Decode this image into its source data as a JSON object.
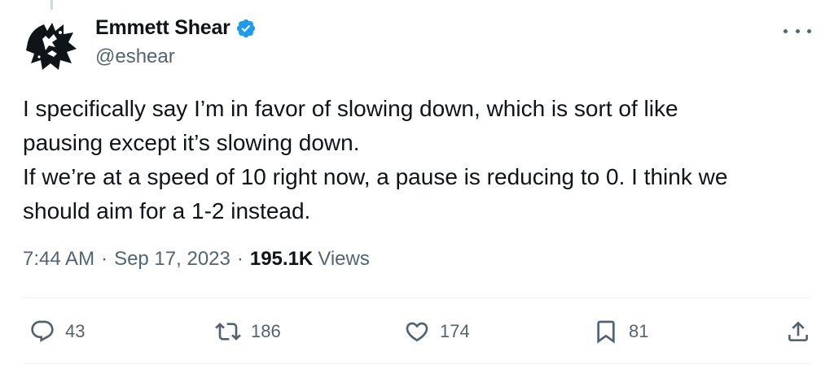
{
  "author": {
    "display_name": "Emmett Shear",
    "handle": "@eshear",
    "verified": true,
    "verified_color": "#1d9bf0"
  },
  "tweet": {
    "lines": [
      "I specifically say I’m in favor of slowing down, which is sort of like",
      "pausing except it’s slowing down.",
      "If we’re at a speed of 10 right now, a pause is reducing to 0. I think we",
      "should aim for a 1-2 instead."
    ]
  },
  "meta": {
    "time": "7:44 AM",
    "date": "Sep 17, 2023",
    "separator": "·",
    "views_count": "195.1K",
    "views_label": "Views"
  },
  "actions": {
    "replies": "43",
    "retweets": "186",
    "likes": "174",
    "bookmarks": "81"
  },
  "icons": {
    "more": "more-dots-icon",
    "reply": "reply-icon",
    "retweet": "retweet-icon",
    "like": "heart-icon",
    "bookmark": "bookmark-icon",
    "share": "share-icon"
  }
}
